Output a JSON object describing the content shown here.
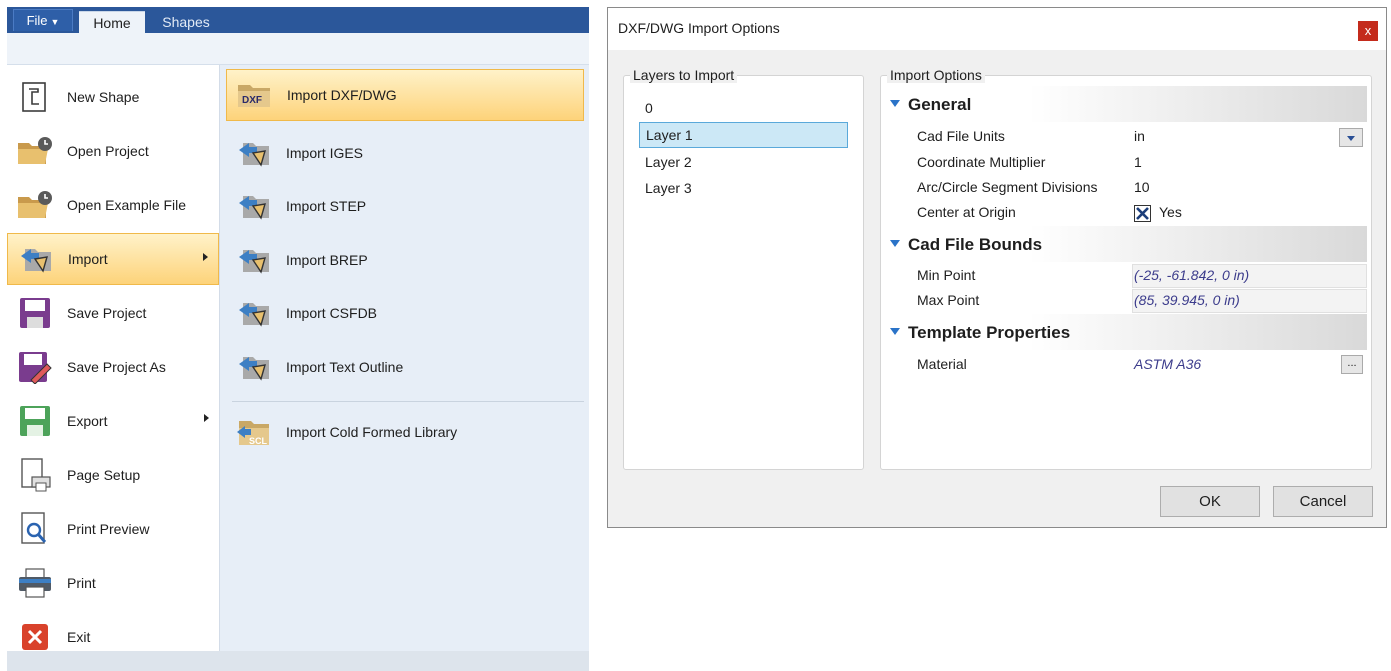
{
  "ribbon": {
    "file_label": "File",
    "tabs": [
      {
        "label": "Home"
      },
      {
        "label": "Shapes"
      }
    ]
  },
  "file_menu": {
    "items": [
      {
        "label": "New Shape",
        "icon": "new-shape-icon"
      },
      {
        "label": "Open Project",
        "icon": "open-folder-icon"
      },
      {
        "label": "Open Example File",
        "icon": "open-folder-icon"
      },
      {
        "label": "Import",
        "icon": "import-icon",
        "submenu": true,
        "selected": true
      },
      {
        "label": "Save Project",
        "icon": "save-icon"
      },
      {
        "label": "Save Project As",
        "icon": "save-as-icon"
      },
      {
        "label": "Export",
        "icon": "export-icon",
        "submenu": true
      },
      {
        "label": "Page Setup",
        "icon": "page-setup-icon"
      },
      {
        "label": "Print Preview",
        "icon": "print-preview-icon"
      },
      {
        "label": "Print",
        "icon": "printer-icon"
      },
      {
        "label": "Exit",
        "icon": "exit-icon"
      }
    ]
  },
  "import_submenu": {
    "items": [
      {
        "label": "Import DXF/DWG",
        "icon": "dxf-folder-icon",
        "badge": "DXF",
        "selected": true
      },
      {
        "label": "Import IGES",
        "icon": "import-folder-icon"
      },
      {
        "label": "Import STEP",
        "icon": "import-folder-icon"
      },
      {
        "label": "Import BREP",
        "icon": "import-folder-icon"
      },
      {
        "label": "Import CSFDB",
        "icon": "import-folder-icon"
      },
      {
        "label": "Import Text Outline",
        "icon": "import-folder-icon"
      },
      {
        "label": "Import Cold Formed Library",
        "icon": "scl-folder-icon",
        "badge": "SCL"
      }
    ]
  },
  "dialog": {
    "title": "DXF/DWG Import Options",
    "close_glyph": "x",
    "layers_title": "Layers to Import",
    "layers": [
      "0",
      "Layer 1",
      "Layer 2",
      "Layer 3"
    ],
    "selected_layer": "Layer 1",
    "options_title": "Import Options",
    "general": {
      "title": "General",
      "cad_file_units_label": "Cad File Units",
      "cad_file_units_value": "in",
      "coordinate_multiplier_label": "Coordinate Multiplier",
      "coordinate_multiplier_value": "1",
      "segment_divisions_label": "Arc/Circle Segment Divisions",
      "segment_divisions_value": "10",
      "center_at_origin_label": "Center at Origin",
      "center_at_origin_value": "Yes",
      "center_at_origin_checked": true
    },
    "bounds": {
      "title": "Cad File Bounds",
      "min_point_label": "Min Point",
      "min_point_value": "(-25, -61.842, 0 in)",
      "max_point_label": "Max Point",
      "max_point_value": "(85, 39.945, 0 in)"
    },
    "template": {
      "title": "Template Properties",
      "material_label": "Material",
      "material_value": "ASTM A36",
      "ellipsis": "..."
    },
    "ok_label": "OK",
    "cancel_label": "Cancel"
  },
  "colors": {
    "ribbon_blue": "#2b579a",
    "selection_orange": "#fdd37a",
    "selection_border": "#f0b94a",
    "list_selection": "#cce8f6",
    "close_red": "#c42b1c",
    "category_triangle": "#2a73c8"
  }
}
